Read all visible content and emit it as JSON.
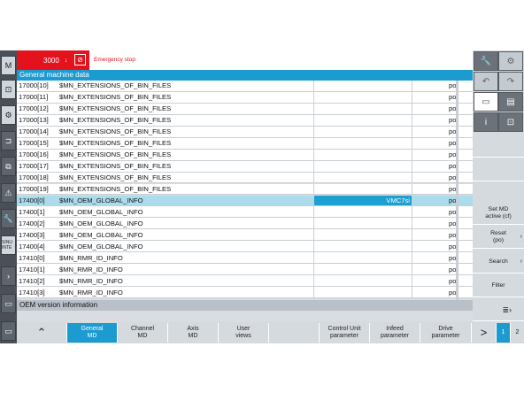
{
  "header": {
    "alarm_number": "3000",
    "alarm_arrow": "↓",
    "ack_icon": "⊘",
    "alarm_text": "Emergency stop"
  },
  "title": "General machine data",
  "rows": [
    {
      "num": "17000[10]",
      "name": "$MN_EXTENSIONS_OF_BIN_FILES",
      "value": "",
      "unit": "po"
    },
    {
      "num": "17000[11]",
      "name": "$MN_EXTENSIONS_OF_BIN_FILES",
      "value": "",
      "unit": "po"
    },
    {
      "num": "17000[12]",
      "name": "$MN_EXTENSIONS_OF_BIN_FILES",
      "value": "",
      "unit": "po"
    },
    {
      "num": "17000[13]",
      "name": "$MN_EXTENSIONS_OF_BIN_FILES",
      "value": "",
      "unit": "po"
    },
    {
      "num": "17000[14]",
      "name": "$MN_EXTENSIONS_OF_BIN_FILES",
      "value": "",
      "unit": "po"
    },
    {
      "num": "17000[15]",
      "name": "$MN_EXTENSIONS_OF_BIN_FILES",
      "value": "",
      "unit": "po"
    },
    {
      "num": "17000[16]",
      "name": "$MN_EXTENSIONS_OF_BIN_FILES",
      "value": "",
      "unit": "po"
    },
    {
      "num": "17000[17]",
      "name": "$MN_EXTENSIONS_OF_BIN_FILES",
      "value": "",
      "unit": "po"
    },
    {
      "num": "17000[18]",
      "name": "$MN_EXTENSIONS_OF_BIN_FILES",
      "value": "",
      "unit": "po"
    },
    {
      "num": "17000[19]",
      "name": "$MN_EXTENSIONS_OF_BIN_FILES",
      "value": "",
      "unit": "po"
    },
    {
      "num": "17400[0]",
      "name": "$MN_OEM_GLOBAL_INFO",
      "value": "VMC7si",
      "unit": "po",
      "selected": true
    },
    {
      "num": "17400[1]",
      "name": "$MN_OEM_GLOBAL_INFO",
      "value": "",
      "unit": "po"
    },
    {
      "num": "17400[2]",
      "name": "$MN_OEM_GLOBAL_INFO",
      "value": "",
      "unit": "po"
    },
    {
      "num": "17400[3]",
      "name": "$MN_OEM_GLOBAL_INFO",
      "value": "",
      "unit": "po"
    },
    {
      "num": "17400[4]",
      "name": "$MN_OEM_GLOBAL_INFO",
      "value": "",
      "unit": "po"
    },
    {
      "num": "17410[0]",
      "name": "$MN_RMR_ID_INFO",
      "value": "",
      "unit": "po"
    },
    {
      "num": "17410[1]",
      "name": "$MN_RMR_ID_INFO",
      "value": "",
      "unit": "po"
    },
    {
      "num": "17410[2]",
      "name": "$MN_RMR_ID_INFO",
      "value": "",
      "unit": "po"
    },
    {
      "num": "17410[3]",
      "name": "$MN_RMR_ID_INFO",
      "value": "",
      "unit": "po"
    }
  ],
  "info_text": "OEM version information",
  "left_bar": [
    "M",
    "⊡",
    "⚙",
    "⊐",
    "⧉",
    "⚠",
    "🔧",
    "SINU INTE",
    "›",
    "▭",
    "▭"
  ],
  "right_icons": [
    "🔧",
    "⚙",
    "↶",
    "↷",
    "▭",
    "▤",
    "i",
    "⊡"
  ],
  "vertical_softkeys": [
    {
      "label": "",
      "arrow": ""
    },
    {
      "label": "",
      "arrow": ""
    },
    {
      "label": "Set MD\nactive (cf)",
      "arrow": ""
    },
    {
      "label": "Reset\n(po)",
      "arrow": "›"
    },
    {
      "label": "Search",
      "arrow": "›"
    },
    {
      "label": "Filter",
      "arrow": ""
    },
    {
      "label": "",
      "arrow": ""
    }
  ],
  "horizontal_softkeys": {
    "up_arrow": "⌃",
    "general": "General\nMD",
    "channel": "Channel\nMD",
    "axis": "Axis\nMD",
    "user": "User\nviews",
    "blank": "",
    "control_unit": "Control Unit\nparameter",
    "infeed": "Infeed\nparameter",
    "drive": "Drive\nparameter",
    "next_arrow": ">",
    "page1": "1",
    "page2": "2"
  },
  "colors": {
    "accent": "#1c9bd1",
    "alarm": "#e3121c",
    "selected_row": "#acdcec"
  }
}
